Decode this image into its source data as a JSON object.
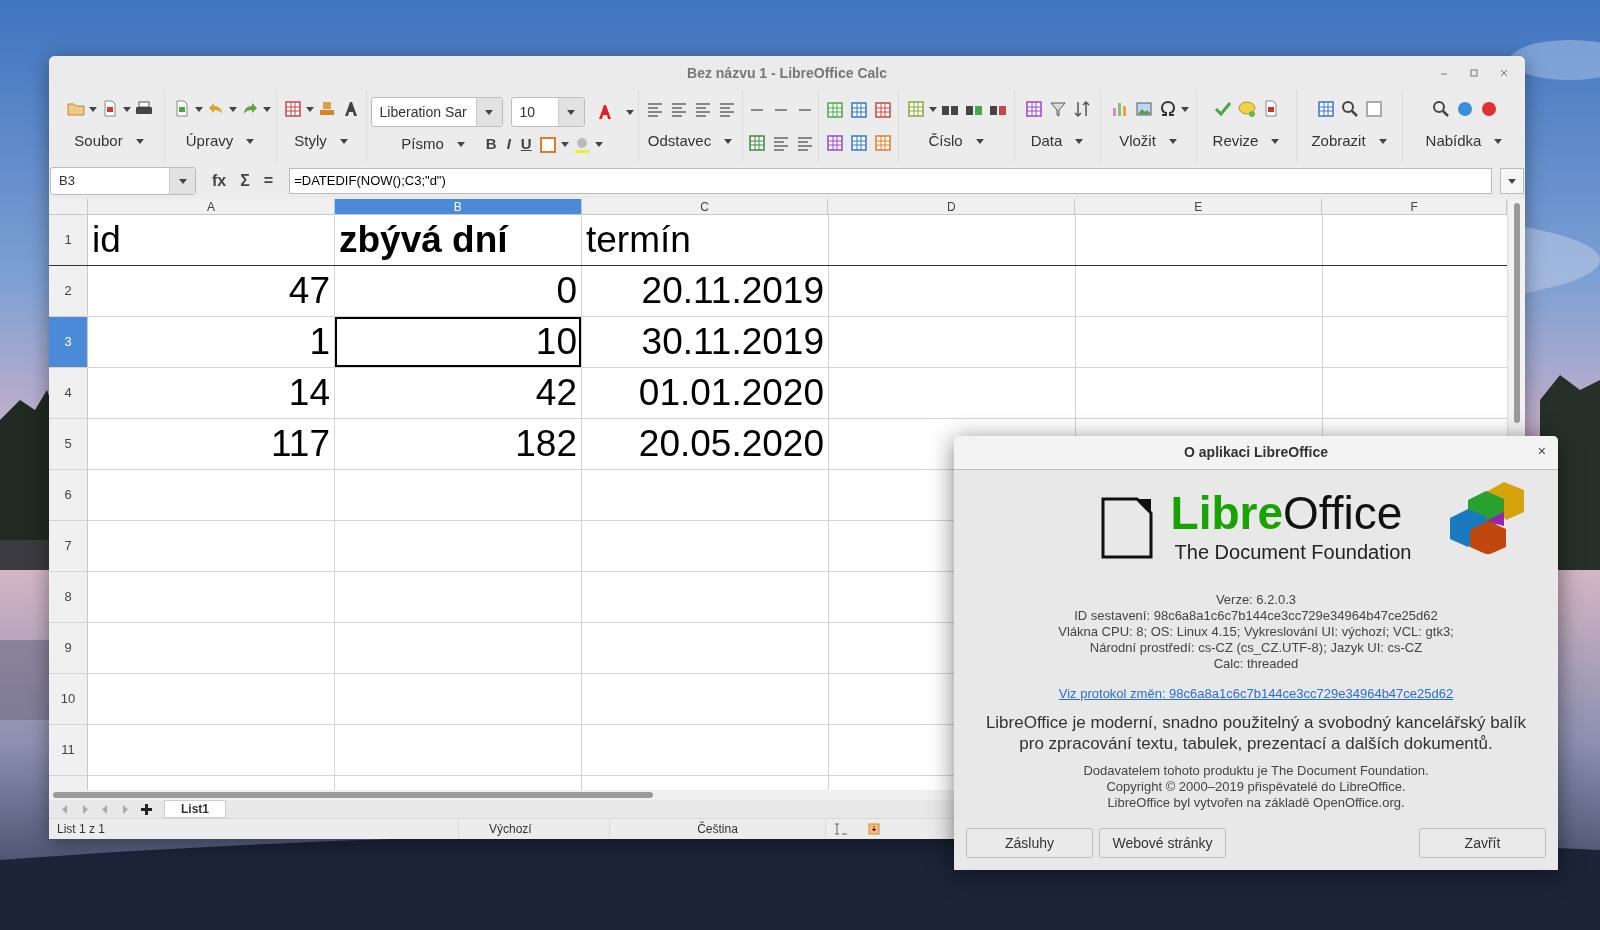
{
  "window": {
    "title": "Bez názvu 1 - LibreOffice Calc"
  },
  "toolbar": {
    "groups": [
      {
        "kind": "labeled",
        "label": "Soubor"
      },
      {
        "kind": "labeled",
        "label": "Úpravy"
      },
      {
        "kind": "labeled",
        "label": "Styly"
      },
      {
        "kind": "font",
        "label": "Písmo",
        "font_name": "Liberation Sar",
        "font_size": "10",
        "format_buttons": [
          "B",
          "I",
          "U"
        ]
      },
      {
        "kind": "labeled",
        "label": "Odstavec"
      },
      {
        "kind": "icons"
      },
      {
        "kind": "icons"
      },
      {
        "kind": "labeled",
        "label": "Číslo"
      },
      {
        "kind": "labeled",
        "label": "Data"
      },
      {
        "kind": "labeled",
        "label": "Vložit"
      },
      {
        "kind": "labeled",
        "label": "Revize"
      },
      {
        "kind": "labeled",
        "label": "Zobrazit"
      },
      {
        "kind": "labeled",
        "label": "Nabídka"
      }
    ]
  },
  "formula_bar": {
    "name_box": "B3",
    "buttons": [
      "fx",
      "Σ",
      "="
    ],
    "formula": "=DATEDIF(NOW();C3;\"d\")"
  },
  "sheet": {
    "columns": [
      {
        "label": "A",
        "selected": false
      },
      {
        "label": "B",
        "selected": true
      },
      {
        "label": "C",
        "selected": false
      },
      {
        "label": "D",
        "selected": false
      },
      {
        "label": "E",
        "selected": false
      },
      {
        "label": "F",
        "selected": false
      }
    ],
    "rows": [
      {
        "header": "1",
        "kind": "text",
        "selected": false,
        "cells": [
          {
            "text": "id",
            "bold": false,
            "selected": false
          },
          {
            "text": "zbývá dní",
            "bold": true,
            "selected": false
          },
          {
            "text": "termín",
            "bold": false,
            "selected": false
          }
        ]
      },
      {
        "header": "2",
        "kind": "number",
        "selected": false,
        "cells": [
          {
            "text": "47",
            "bold": false,
            "selected": false
          },
          {
            "text": "0",
            "bold": false,
            "selected": false
          },
          {
            "text": "20.11.2019",
            "bold": false,
            "selected": false
          }
        ]
      },
      {
        "header": "3",
        "kind": "number",
        "selected": true,
        "cells": [
          {
            "text": "1",
            "bold": false,
            "selected": false
          },
          {
            "text": "10",
            "bold": false,
            "selected": true
          },
          {
            "text": "30.11.2019",
            "bold": false,
            "selected": false
          }
        ]
      },
      {
        "header": "4",
        "kind": "number",
        "selected": false,
        "cells": [
          {
            "text": "14",
            "bold": false,
            "selected": false
          },
          {
            "text": "42",
            "bold": false,
            "selected": false
          },
          {
            "text": "01.01.2020",
            "bold": false,
            "selected": false
          }
        ]
      },
      {
        "header": "5",
        "kind": "number",
        "selected": false,
        "cells": [
          {
            "text": "117",
            "bold": false,
            "selected": false
          },
          {
            "text": "182",
            "bold": false,
            "selected": false
          },
          {
            "text": "20.05.2020",
            "bold": false,
            "selected": false
          }
        ]
      },
      {
        "header": "6",
        "kind": "empty",
        "selected": false
      },
      {
        "header": "7",
        "kind": "empty",
        "selected": false
      },
      {
        "header": "8",
        "kind": "empty",
        "selected": false
      },
      {
        "header": "9",
        "kind": "empty",
        "selected": false
      },
      {
        "header": "10",
        "kind": "empty",
        "selected": false
      },
      {
        "header": "11",
        "kind": "empty",
        "selected": false
      }
    ]
  },
  "sheet_tabs": [
    {
      "label": "List1",
      "selected": true
    }
  ],
  "status_bar": [
    "List 1 z 1",
    "Výchozí",
    "Čeština"
  ],
  "dialog": {
    "title": "O aplikaci LibreOffice",
    "close": "×",
    "logo": {
      "word_1": "Libre",
      "word_2": "Office",
      "tagline": "The Document Foundation"
    },
    "info": [
      "Verze: 6.2.0.3",
      "ID sestavení: 98c6a8a1c6c7b144ce3cc729e34964b47ce25d62",
      "Vlákna CPU: 8; OS: Linux 4.15; Vykreslování UI: výchozí; VCL: gtk3;",
      "Národní prostředí: cs-CZ (cs_CZ.UTF-8); Jazyk UI: cs-CZ",
      "Calc: threaded"
    ],
    "link": "Viz protokol změn: 98c6a8a1c6c7b144ce3cc729e34964b47ce25d62",
    "description": "LibreOffice je moderní, snadno použitelný a svobodný kancelářský balík pro zpracování textu, tabulek, prezentací a dalších dokumentů.",
    "credits": [
      "Dodavatelem tohoto produktu je The Document Foundation.",
      "Copyright © 2000–2019 přispěvatelé do LibreOffice.",
      "LibreOffice byl vytvořen na základě OpenOffice.org."
    ],
    "buttons": [
      "Zásluhy",
      "Webové stránky",
      "Zavřít"
    ]
  }
}
